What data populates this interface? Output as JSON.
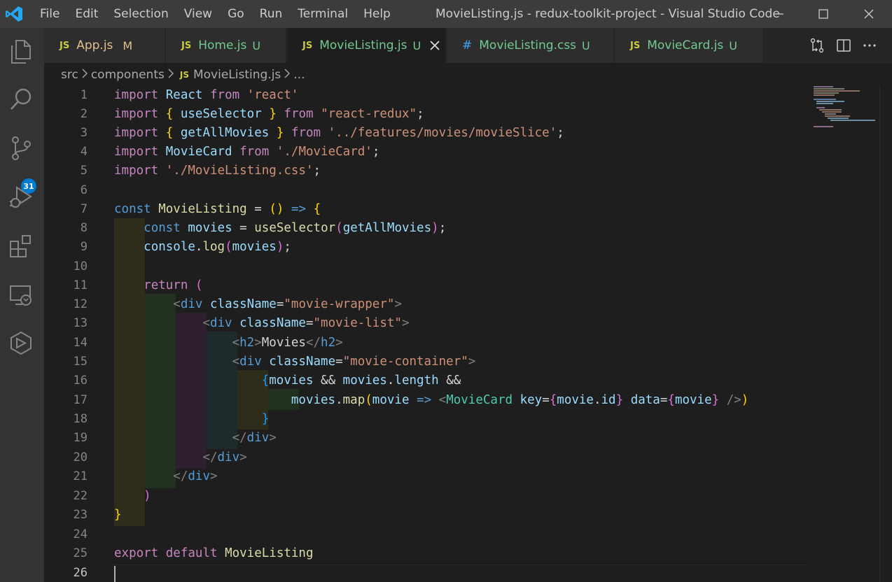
{
  "window": {
    "title": "MovieListing.js - redux-toolkit-project - Visual Studio Code"
  },
  "menu": [
    "File",
    "Edit",
    "Selection",
    "View",
    "Go",
    "Run",
    "Terminal",
    "Help"
  ],
  "activity_bar": {
    "scm_badge": "31",
    "icons": [
      "explorer-icon",
      "search-icon",
      "source-control-icon",
      "run-debug-icon",
      "extensions-icon",
      "remote-explorer-icon",
      "cube-icon"
    ]
  },
  "tabs": [
    {
      "icon": "JS",
      "label": "App.js",
      "status": "M",
      "active": false
    },
    {
      "icon": "JS",
      "label": "Home.js",
      "status": "U",
      "active": false
    },
    {
      "icon": "JS",
      "label": "MovieListing.js",
      "status": "U",
      "active": true
    },
    {
      "icon": "#",
      "label": "MovieListing.css",
      "status": "U",
      "active": false
    },
    {
      "icon": "JS",
      "label": "MovieCard.js",
      "status": "U",
      "active": false
    }
  ],
  "breadcrumb": {
    "parts": [
      "src",
      "components"
    ],
    "file_icon": "JS",
    "file": "MovieListing.js",
    "tail": "..."
  },
  "editor": {
    "current_line": 26,
    "line_numbers": [
      "1",
      "2",
      "3",
      "4",
      "5",
      "6",
      "7",
      "8",
      "9",
      "10",
      "11",
      "12",
      "13",
      "14",
      "15",
      "16",
      "17",
      "18",
      "19",
      "20",
      "21",
      "22",
      "23",
      "24",
      "25",
      "26"
    ],
    "lines": [
      "import React from 'react'",
      "import { useSelector } from \"react-redux\";",
      "import { getAllMovies } from '../features/movies/movieSlice';",
      "import MovieCard from './MovieCard';",
      "import './MovieListing.css';",
      "",
      "const MovieListing = () => {",
      "    const movies = useSelector(getAllMovies);",
      "    console.log(movies);",
      "",
      "    return (",
      "        <div className=\"movie-wrapper\">",
      "            <div className=\"movie-list\">",
      "                <h2>Movies</h2>",
      "                <div className=\"movie-container\">",
      "                    {movies && movies.length &&",
      "                        movies.map(movie => <MovieCard key={movie.id} data={movie} />)",
      "                    }",
      "                </div>",
      "            </div>",
      "        </div>",
      "    )",
      "}",
      "",
      "export default MovieListing",
      ""
    ]
  },
  "colors": {
    "titlebar": "#3c3c3c",
    "activitybar": "#333333",
    "editor_bg": "#1e1e1e",
    "accent": "#007acc",
    "untracked": "#73c991",
    "modified": "#e2c08d"
  }
}
